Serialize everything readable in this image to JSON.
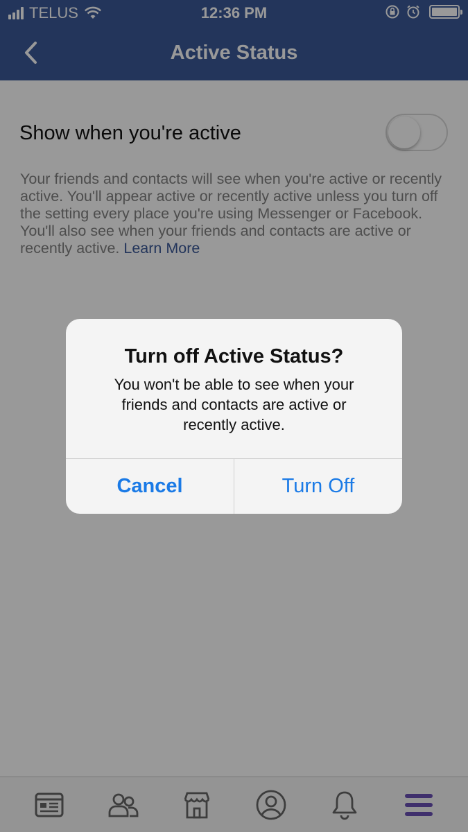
{
  "status_bar": {
    "carrier": "TELUS",
    "time": "12:36 PM"
  },
  "nav": {
    "title": "Active Status"
  },
  "setting": {
    "label": "Show when you're active",
    "enabled": false
  },
  "description": {
    "text": "Your friends and contacts will see when you're active or recently active. You'll appear active or recently active unless you turn off the setting every place you're using Messenger or Facebook. You'll also see when your friends and contacts are active or recently active. ",
    "link": "Learn More"
  },
  "alert": {
    "title": "Turn off Active Status?",
    "message": "You won't be able to see when your friends and contacts are active or recently active.",
    "cancel_label": "Cancel",
    "confirm_label": "Turn Off"
  },
  "tabs": [
    {
      "icon": "news-feed-icon"
    },
    {
      "icon": "friends-icon"
    },
    {
      "icon": "marketplace-icon"
    },
    {
      "icon": "profile-icon"
    },
    {
      "icon": "notifications-icon"
    },
    {
      "icon": "menu-icon",
      "active": true
    }
  ],
  "colors": {
    "brand": "#3b5998",
    "accent_link": "#1a7ae6",
    "active_tab": "#6a4fb5",
    "inactive_tab": "#666666"
  }
}
